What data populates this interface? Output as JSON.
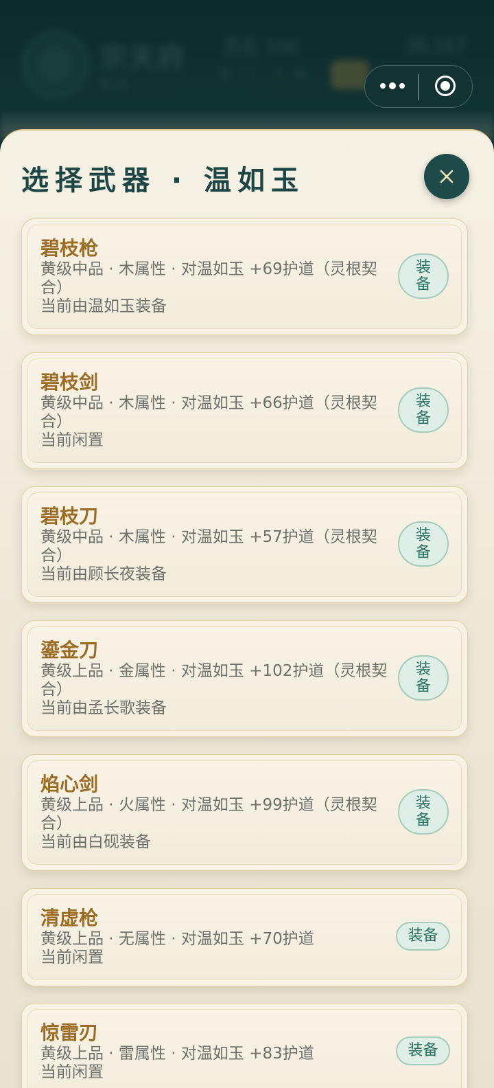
{
  "background": {
    "app_title": "宗天府",
    "subtitle": "第1日",
    "stat_left": "灵石 100",
    "stat_right": "38,167",
    "pills": "宗门 人物"
  },
  "modal": {
    "title": "选择武器 · 温如玉",
    "close_symbol": "×"
  },
  "weapons": [
    {
      "name": "碧枝枪",
      "desc": "黄级中品 · 木属性 · 对温如玉 +69护道（灵根契合）",
      "status": "当前由温如玉装备",
      "action": "装备"
    },
    {
      "name": "碧枝剑",
      "desc": "黄级中品 · 木属性 · 对温如玉 +66护道（灵根契合）",
      "status": "当前闲置",
      "action": "装备"
    },
    {
      "name": "碧枝刀",
      "desc": "黄级中品 · 木属性 · 对温如玉 +57护道（灵根契合）",
      "status": "当前由顾长夜装备",
      "action": "装备"
    },
    {
      "name": "鎏金刀",
      "desc": "黄级上品 · 金属性 · 对温如玉 +102护道（灵根契合）",
      "status": "当前由孟长歌装备",
      "action": "装备"
    },
    {
      "name": "焰心剑",
      "desc": "黄级上品 · 火属性 · 对温如玉 +99护道（灵根契合）",
      "status": "当前由白砚装备",
      "action": "装备"
    },
    {
      "name": "清虚枪",
      "desc": "黄级上品 · 无属性 · 对温如玉 +70护道",
      "status": "当前闲置",
      "action": "装备"
    },
    {
      "name": "惊雷刃",
      "desc": "黄级上品 · 雷属性 · 对温如玉 +83护道",
      "status": "当前闲置",
      "action": "装备"
    }
  ]
}
